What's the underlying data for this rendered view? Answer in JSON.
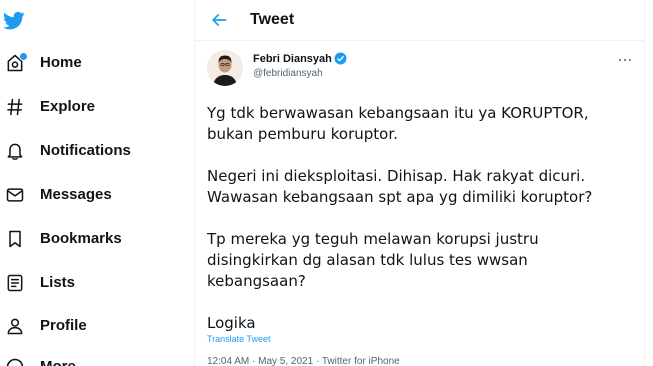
{
  "sidebar": {
    "items": [
      {
        "label": "Home",
        "icon": "home-icon"
      },
      {
        "label": "Explore",
        "icon": "hashtag-icon"
      },
      {
        "label": "Notifications",
        "icon": "bell-icon"
      },
      {
        "label": "Messages",
        "icon": "envelope-icon"
      },
      {
        "label": "Bookmarks",
        "icon": "bookmark-icon"
      },
      {
        "label": "Lists",
        "icon": "list-icon"
      },
      {
        "label": "Profile",
        "icon": "person-icon"
      },
      {
        "label": "More",
        "icon": "more-circle-icon"
      }
    ]
  },
  "header": {
    "title": "Tweet"
  },
  "tweet": {
    "author_name": "Febri Diansyah",
    "author_handle": "@febridiansyah",
    "paragraphs": [
      "Yg tdk berwawasan kebangsaan itu ya KORUPTOR,\nbukan pemburu koruptor.",
      "Negeri ini dieksploitasi. Dihisap. Hak rakyat dicuri.\nWawasan kebangsaan spt apa yg dimiliki koruptor?",
      "Tp mereka yg teguh melawan korupsi justru\ndisingkirkan dg alasan tdk lulus tes wwsan\nkebangsaan?",
      "Logika"
    ],
    "translate_label": "Translate Tweet",
    "meta": "12:04 AM · May 5, 2021 · Twitter for iPhone"
  },
  "colors": {
    "accent": "#1d9bf0",
    "text": "#0f1419",
    "muted": "#536471"
  }
}
